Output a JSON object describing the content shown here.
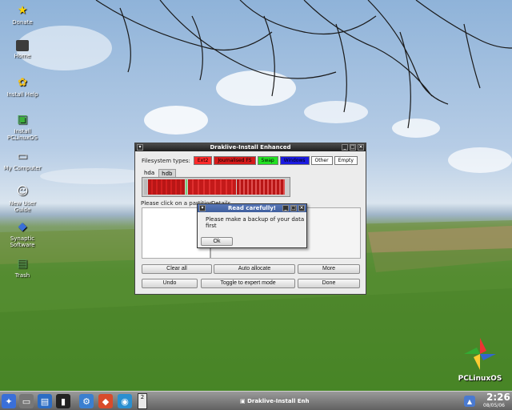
{
  "desktop": {
    "icons": [
      {
        "label": "Donate"
      },
      {
        "label": "Home"
      },
      {
        "label": "Install Help"
      },
      {
        "label": "Install PCLinuxOS"
      },
      {
        "label": "My Computer"
      },
      {
        "label": "New User Guide"
      },
      {
        "label": "Synaptic Software"
      },
      {
        "label": "Trash"
      }
    ],
    "brand": "PCLinuxOS"
  },
  "main_window": {
    "title": "Draklive-Install Enhanced",
    "fs_types_label": "Filesystem types:",
    "fs_types": [
      {
        "label": "Ext2",
        "color": "#ff2a2a"
      },
      {
        "label": "Journalised FS",
        "color": "#d41a1a"
      },
      {
        "label": "Swap",
        "color": "#22e022"
      },
      {
        "label": "Windows",
        "color": "#1a1ae0"
      },
      {
        "label": "Other",
        "color": "#ffffff"
      },
      {
        "label": "Empty",
        "color": "#ffffff"
      }
    ],
    "disk_tabs": [
      "hda",
      "hdb"
    ],
    "hint": "Please click on a partition",
    "details_label": "Details",
    "buttons": {
      "clear_all": "Clear all",
      "auto_allocate": "Auto allocate",
      "more": "More",
      "undo": "Undo",
      "toggle_expert": "Toggle to expert mode",
      "done": "Done"
    }
  },
  "dialog": {
    "title": "Read carefully!",
    "message": "Please make a backup of your data first",
    "ok_label": "Ok"
  },
  "taskbar": {
    "pager_top": "",
    "pager_bottom": "2",
    "task_label": "Draklive-Install Enh",
    "time": "2:26",
    "date": "08/05/06"
  }
}
